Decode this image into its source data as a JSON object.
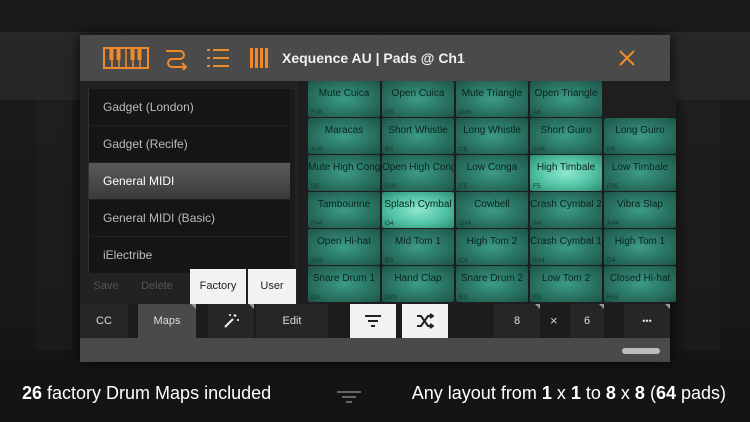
{
  "window": {
    "title": "Xequence AU | Pads @ Ch1",
    "accent": "#f08a2a"
  },
  "map_list": {
    "items": [
      {
        "label": "Gadget (London)",
        "active": false
      },
      {
        "label": "Gadget (Recife)",
        "active": false
      },
      {
        "label": "General MIDI",
        "active": true
      },
      {
        "label": "General MIDI (Basic)",
        "active": false
      },
      {
        "label": "iElectribe",
        "active": false
      }
    ],
    "actions": {
      "save": "Save",
      "delete": "Delete",
      "factory": "Factory",
      "user": "User"
    }
  },
  "pads": {
    "rows": [
      [
        {
          "name": "Mute Cuica",
          "note": "F#6"
        },
        {
          "name": "Open Cuica",
          "note": "G6"
        },
        {
          "name": "Mute Triangle",
          "note": "G#6"
        },
        {
          "name": "Open Triangle",
          "note": "A6"
        },
        {
          "name": "",
          "note": ""
        }
      ],
      [
        {
          "name": "Maracas",
          "note": "A#5"
        },
        {
          "name": "Short Whistle",
          "note": "B5"
        },
        {
          "name": "Long Whistle",
          "note": "C6"
        },
        {
          "name": "Short Guiro",
          "note": "C#6"
        },
        {
          "name": "Long Guiro",
          "note": "D6"
        }
      ],
      [
        {
          "name": "Mute High Conga",
          "note": "D5"
        },
        {
          "name": "Open High Conga",
          "note": "D#5"
        },
        {
          "name": "Low Conga",
          "note": "E5"
        },
        {
          "name": "High Timbale",
          "note": "F5"
        },
        {
          "name": "Low Timbale",
          "note": "F#5"
        }
      ],
      [
        {
          "name": "Tambourine",
          "note": "F#4"
        },
        {
          "name": "Splash Cymbal",
          "note": "G4"
        },
        {
          "name": "Cowbell",
          "note": "G#4"
        },
        {
          "name": "Crash Cymbal 2",
          "note": "A4"
        },
        {
          "name": "Vibra Slap",
          "note": "A#4"
        }
      ],
      [
        {
          "name": "Open Hi-hat",
          "note": "A#3"
        },
        {
          "name": "Mid Tom 1",
          "note": "B3"
        },
        {
          "name": "High Tom 2",
          "note": "C4"
        },
        {
          "name": "Crash Cymbal 1",
          "note": "C#4"
        },
        {
          "name": "High Tom 1",
          "note": "D4"
        }
      ],
      [
        {
          "name": "Snare Drum 1",
          "note": "D3"
        },
        {
          "name": "Hand Clap",
          "note": "D#3"
        },
        {
          "name": "Snare Drum 2",
          "note": "E3"
        },
        {
          "name": "Low Tom 2",
          "note": "F3"
        },
        {
          "name": "Closed Hi-hat",
          "note": "F#3"
        }
      ]
    ],
    "bright": [
      "2-3",
      "3-1"
    ]
  },
  "toolbar": {
    "cc": "CC",
    "maps": "Maps",
    "edit": "Edit",
    "cols": "8",
    "times": "×",
    "rows": "6",
    "more": "•••"
  },
  "caption": {
    "left_count": "26",
    "left_text": " factory Drum Maps included",
    "right_1": "Any layout from ",
    "right_2": "1",
    "right_3": " x ",
    "right_4": "1",
    "right_5": " to ",
    "right_6": "8",
    "right_7": " x ",
    "right_8": "8",
    "right_9": " (",
    "right_10": "64",
    "right_11": " pads)"
  }
}
